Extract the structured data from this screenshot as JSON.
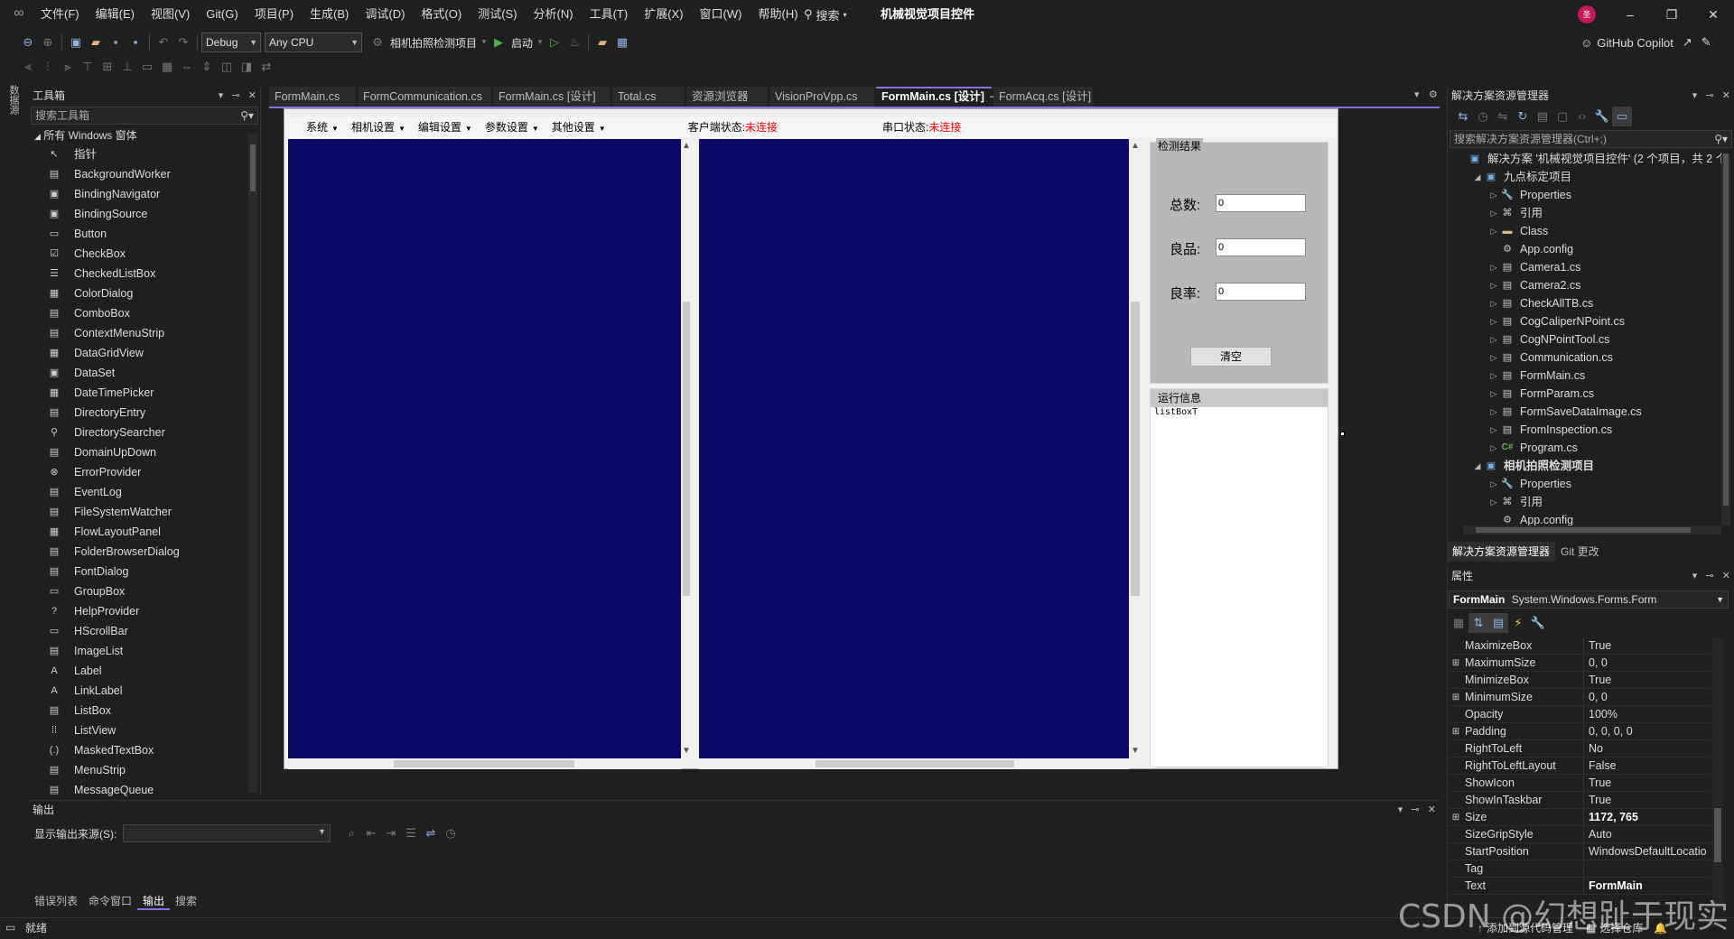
{
  "menubar": {
    "items": [
      "文件(F)",
      "编辑(E)",
      "视图(V)",
      "Git(G)",
      "项目(P)",
      "生成(B)",
      "调试(D)",
      "格式(O)",
      "测试(S)",
      "分析(N)",
      "工具(T)",
      "扩展(X)",
      "窗口(W)",
      "帮助(H)"
    ],
    "search_label": "搜索",
    "app_title": "机械视觉项目控件",
    "avatar_text": "圣",
    "avatar_color": "#c2185b"
  },
  "toolbar": {
    "config": "Debug",
    "platform": "Any CPU",
    "startup_project": "相机拍照检测项目",
    "start_label": "启动",
    "copilot_label": "GitHub Copilot"
  },
  "side_strip": {
    "label": "数据源"
  },
  "toolbox": {
    "title": "工具箱",
    "search_placeholder": "搜索工具箱",
    "group": "所有 Windows 窗体",
    "items": [
      {
        "label": "指针",
        "icon": "pointer-icon",
        "glyph": "↖"
      },
      {
        "label": "BackgroundWorker",
        "icon": "background-worker-icon",
        "glyph": "▤"
      },
      {
        "label": "BindingNavigator",
        "icon": "binding-navigator-icon",
        "glyph": "▣"
      },
      {
        "label": "BindingSource",
        "icon": "binding-source-icon",
        "glyph": "▣"
      },
      {
        "label": "Button",
        "icon": "button-icon",
        "glyph": "▭"
      },
      {
        "label": "CheckBox",
        "icon": "checkbox-icon",
        "glyph": "☑"
      },
      {
        "label": "CheckedListBox",
        "icon": "checked-listbox-icon",
        "glyph": "☰"
      },
      {
        "label": "ColorDialog",
        "icon": "color-dialog-icon",
        "glyph": "▦"
      },
      {
        "label": "ComboBox",
        "icon": "combobox-icon",
        "glyph": "▤"
      },
      {
        "label": "ContextMenuStrip",
        "icon": "context-menu-strip-icon",
        "glyph": "▤"
      },
      {
        "label": "DataGridView",
        "icon": "datagridview-icon",
        "glyph": "▦"
      },
      {
        "label": "DataSet",
        "icon": "dataset-icon",
        "glyph": "▣"
      },
      {
        "label": "DateTimePicker",
        "icon": "datetimepicker-icon",
        "glyph": "▦"
      },
      {
        "label": "DirectoryEntry",
        "icon": "directory-entry-icon",
        "glyph": "▤"
      },
      {
        "label": "DirectorySearcher",
        "icon": "directory-searcher-icon",
        "glyph": "⚲"
      },
      {
        "label": "DomainUpDown",
        "icon": "domain-updown-icon",
        "glyph": "▤"
      },
      {
        "label": "ErrorProvider",
        "icon": "error-provider-icon",
        "glyph": "⊗"
      },
      {
        "label": "EventLog",
        "icon": "eventlog-icon",
        "glyph": "▤"
      },
      {
        "label": "FileSystemWatcher",
        "icon": "filesystemwatcher-icon",
        "glyph": "▤"
      },
      {
        "label": "FlowLayoutPanel",
        "icon": "flowlayoutpanel-icon",
        "glyph": "▦"
      },
      {
        "label": "FolderBrowserDialog",
        "icon": "folder-browser-dialog-icon",
        "glyph": "▤"
      },
      {
        "label": "FontDialog",
        "icon": "font-dialog-icon",
        "glyph": "▤"
      },
      {
        "label": "GroupBox",
        "icon": "groupbox-icon",
        "glyph": "▭"
      },
      {
        "label": "HelpProvider",
        "icon": "help-provider-icon",
        "glyph": "?"
      },
      {
        "label": "HScrollBar",
        "icon": "hscrollbar-icon",
        "glyph": "▭"
      },
      {
        "label": "ImageList",
        "icon": "imagelist-icon",
        "glyph": "▤"
      },
      {
        "label": "Label",
        "icon": "label-icon",
        "glyph": "A"
      },
      {
        "label": "LinkLabel",
        "icon": "linklabel-icon",
        "glyph": "A"
      },
      {
        "label": "ListBox",
        "icon": "listbox-icon",
        "glyph": "▤"
      },
      {
        "label": "ListView",
        "icon": "listview-icon",
        "glyph": "⁞⁞"
      },
      {
        "label": "MaskedTextBox",
        "icon": "masked-textbox-icon",
        "glyph": "(.)"
      },
      {
        "label": "MenuStrip",
        "icon": "menustrip-icon",
        "glyph": "▤"
      },
      {
        "label": "MessageQueue",
        "icon": "messagequeue-icon",
        "glyph": "▤"
      }
    ]
  },
  "editor": {
    "tabs": [
      {
        "label": "FormMain.cs",
        "active": false
      },
      {
        "label": "FormCommunication.cs",
        "active": false
      },
      {
        "label": "FormMain.cs [设计]",
        "active": false
      },
      {
        "label": "Total.cs",
        "active": false
      },
      {
        "label": "资源浏览器",
        "active": false
      },
      {
        "label": "VisionProVpp.cs",
        "active": false
      },
      {
        "label": "FormMain.cs [设计]",
        "active": true
      },
      {
        "label": "FormAcq.cs [设计]",
        "active": false
      }
    ],
    "active_tab_pin": "⊸",
    "active_tab_close": "✕",
    "accent_color": "#8c6ee8"
  },
  "form": {
    "menus": [
      {
        "label": "系统"
      },
      {
        "label": "相机设置"
      },
      {
        "label": "编辑设置"
      },
      {
        "label": "参数设置"
      },
      {
        "label": "其他设置"
      }
    ],
    "client_status_label": "客户端状态:",
    "client_status_value": "未连接",
    "serial_status_label": "串口状态:",
    "serial_status_value": "未连接",
    "picture_color": "#0a0a66",
    "result_group_title": "检测结果",
    "fields": [
      {
        "label": "总数:",
        "value": "0"
      },
      {
        "label": "良品:",
        "value": "0"
      },
      {
        "label": "良率:",
        "value": "0"
      }
    ],
    "clear_button": "清空",
    "run_group_title": "运行信息",
    "listbox_name": "listBoxT"
  },
  "output": {
    "title": "输出",
    "source_label": "显示输出来源(S):",
    "source_value": "",
    "bottom_tabs": [
      {
        "label": "错误列表",
        "active": false
      },
      {
        "label": "命令窗口",
        "active": false
      },
      {
        "label": "输出",
        "active": true
      },
      {
        "label": "搜索",
        "active": false
      }
    ]
  },
  "statusbar": {
    "text": "就绪",
    "add_source_control": "添加到源代码管理",
    "select_repo": "选择仓库"
  },
  "watermark": "CSDN @幻想趾于现实",
  "solution_explorer": {
    "title": "解决方案资源管理器",
    "search_placeholder": "搜索解决方案资源管理器(Ctrl+;)",
    "items": [
      {
        "label": "解决方案 '机械视觉项目控件' (2 个项目，共 2 个)",
        "level": 0,
        "icon": "solution-icon",
        "glyph": "▣",
        "expander": "",
        "bold": false,
        "kind": "proj"
      },
      {
        "label": "九点标定项目",
        "level": 1,
        "icon": "project-icon",
        "glyph": "▣",
        "expander": "◢",
        "bold": false,
        "kind": "proj"
      },
      {
        "label": "Properties",
        "level": 2,
        "icon": "wrench-icon",
        "glyph": "🔧",
        "expander": "▷",
        "bold": false,
        "kind": ""
      },
      {
        "label": "引用",
        "level": 2,
        "icon": "references-icon",
        "glyph": "⌘",
        "expander": "▷",
        "bold": false,
        "kind": ""
      },
      {
        "label": "Class",
        "level": 2,
        "icon": "folder-icon",
        "glyph": "▬",
        "expander": "▷",
        "bold": false,
        "kind": "folder"
      },
      {
        "label": "App.config",
        "level": 2,
        "icon": "config-icon",
        "glyph": "⚙",
        "expander": "",
        "bold": false,
        "kind": ""
      },
      {
        "label": "Camera1.cs",
        "level": 2,
        "icon": "form-file-icon",
        "glyph": "▤",
        "expander": "▷",
        "bold": false,
        "kind": ""
      },
      {
        "label": "Camera2.cs",
        "level": 2,
        "icon": "form-file-icon",
        "glyph": "▤",
        "expander": "▷",
        "bold": false,
        "kind": ""
      },
      {
        "label": "CheckAllTB.cs",
        "level": 2,
        "icon": "form-file-icon",
        "glyph": "▤",
        "expander": "▷",
        "bold": false,
        "kind": ""
      },
      {
        "label": "CogCaliperNPoint.cs",
        "level": 2,
        "icon": "form-file-icon",
        "glyph": "▤",
        "expander": "▷",
        "bold": false,
        "kind": ""
      },
      {
        "label": "CogNPointTool.cs",
        "level": 2,
        "icon": "form-file-icon",
        "glyph": "▤",
        "expander": "▷",
        "bold": false,
        "kind": ""
      },
      {
        "label": "Communication.cs",
        "level": 2,
        "icon": "form-file-icon",
        "glyph": "▤",
        "expander": "▷",
        "bold": false,
        "kind": ""
      },
      {
        "label": "FormMain.cs",
        "level": 2,
        "icon": "form-file-icon",
        "glyph": "▤",
        "expander": "▷",
        "bold": false,
        "kind": ""
      },
      {
        "label": "FormParam.cs",
        "level": 2,
        "icon": "form-file-icon",
        "glyph": "▤",
        "expander": "▷",
        "bold": false,
        "kind": ""
      },
      {
        "label": "FormSaveDataImage.cs",
        "level": 2,
        "icon": "form-file-icon",
        "glyph": "▤",
        "expander": "▷",
        "bold": false,
        "kind": ""
      },
      {
        "label": "FromInspection.cs",
        "level": 2,
        "icon": "form-file-icon",
        "glyph": "▤",
        "expander": "▷",
        "bold": false,
        "kind": ""
      },
      {
        "label": "Program.cs",
        "level": 2,
        "icon": "csharp-file-icon",
        "glyph": "C#",
        "expander": "▷",
        "bold": false,
        "kind": "cs"
      },
      {
        "label": "相机拍照检测项目",
        "level": 1,
        "icon": "project-icon",
        "glyph": "▣",
        "expander": "◢",
        "bold": true,
        "kind": "proj"
      },
      {
        "label": "Properties",
        "level": 2,
        "icon": "wrench-icon",
        "glyph": "🔧",
        "expander": "▷",
        "bold": false,
        "kind": ""
      },
      {
        "label": "引用",
        "level": 2,
        "icon": "references-icon",
        "glyph": "⌘",
        "expander": "▷",
        "bold": false,
        "kind": ""
      },
      {
        "label": "App.config",
        "level": 2,
        "icon": "config-icon",
        "glyph": "⚙",
        "expander": "",
        "bold": false,
        "kind": ""
      }
    ],
    "tabs": [
      {
        "label": "解决方案资源管理器",
        "active": true
      },
      {
        "label": "Git 更改",
        "active": false
      }
    ]
  },
  "properties": {
    "title": "属性",
    "object_name": "FormMain",
    "object_type": "System.Windows.Forms.Form",
    "rows": [
      {
        "name": "MaximizeBox",
        "value": "True",
        "expandable": false,
        "bold": false
      },
      {
        "name": "MaximumSize",
        "value": "0, 0",
        "expandable": true,
        "bold": false
      },
      {
        "name": "MinimizeBox",
        "value": "True",
        "expandable": false,
        "bold": false
      },
      {
        "name": "MinimumSize",
        "value": "0, 0",
        "expandable": true,
        "bold": false
      },
      {
        "name": "Opacity",
        "value": "100%",
        "expandable": false,
        "bold": false
      },
      {
        "name": "Padding",
        "value": "0, 0, 0, 0",
        "expandable": true,
        "bold": false
      },
      {
        "name": "RightToLeft",
        "value": "No",
        "expandable": false,
        "bold": false
      },
      {
        "name": "RightToLeftLayout",
        "value": "False",
        "expandable": false,
        "bold": false
      },
      {
        "name": "ShowIcon",
        "value": "True",
        "expandable": false,
        "bold": false
      },
      {
        "name": "ShowInTaskbar",
        "value": "True",
        "expandable": false,
        "bold": false
      },
      {
        "name": "Size",
        "value": "1172, 765",
        "expandable": true,
        "bold": true
      },
      {
        "name": "SizeGripStyle",
        "value": "Auto",
        "expandable": false,
        "bold": false
      },
      {
        "name": "StartPosition",
        "value": "WindowsDefaultLocatio",
        "expandable": false,
        "bold": false
      },
      {
        "name": "Tag",
        "value": "",
        "expandable": false,
        "bold": false
      },
      {
        "name": "Text",
        "value": "FormMain",
        "expandable": false,
        "bold": true
      }
    ]
  }
}
